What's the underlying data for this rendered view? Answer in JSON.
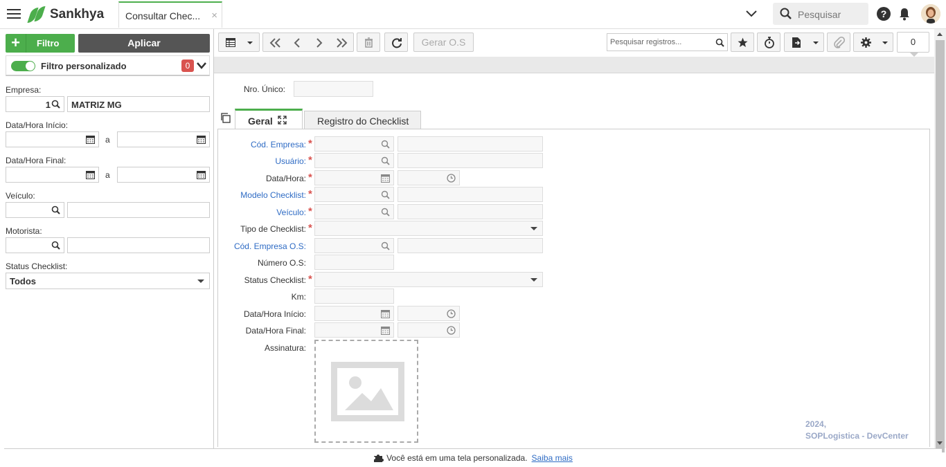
{
  "header": {
    "brand": "Sankhya",
    "tab_title": "Consultar Chec...",
    "tab_close": "×",
    "search_placeholder": "Pesquisar",
    "help_label": "?"
  },
  "filter_panel": {
    "filtro_button": "Filtro",
    "aplicar_button": "Aplicar",
    "custom_filter_label": "Filtro personalizado",
    "custom_filter_count": "0",
    "empresa_label": "Empresa:",
    "empresa_code": "1",
    "empresa_name": "MATRIZ MG",
    "data_inicio_label": "Data/Hora Início:",
    "data_final_label": "Data/Hora Final:",
    "range_sep": "a",
    "veiculo_label": "Veículo:",
    "motorista_label": "Motorista:",
    "status_label": "Status Checklist:",
    "status_value": "Todos"
  },
  "toolbar": {
    "gerar_os": "Gerar O.S",
    "search_placeholder": "Pesquisar registros...",
    "record_count": "0"
  },
  "form": {
    "nro_unico_label": "Nro. Único:",
    "tabs": [
      {
        "label": "Geral"
      },
      {
        "label": "Registro do Checklist"
      }
    ],
    "fields": {
      "cod_empresa": "Cód. Empresa:",
      "usuario": "Usuário:",
      "data_hora": "Data/Hora:",
      "modelo_checklist": "Modelo Checklist:",
      "veiculo": "Veículo:",
      "tipo_checklist": "Tipo de Checklist:",
      "cod_empresa_os": "Cód. Empresa O.S:",
      "numero_os": "Número O.S:",
      "status_checklist": "Status Checklist:",
      "km": "Km:",
      "data_hora_inicio": "Data/Hora Início:",
      "data_hora_final": "Data/Hora Final:",
      "assinatura": "Assinatura:"
    },
    "required_mark": "*"
  },
  "dev_note": {
    "line1": "2024,",
    "line2": "SOPLogistica - DevCenter"
  },
  "footer": {
    "text": "Você está em uma tela personalizada.",
    "link": "Saiba mais"
  },
  "colors": {
    "brand_green": "#4cae4c",
    "required_red": "#d9534f",
    "link_blue": "#2e6bc4",
    "dark_button": "#555555"
  }
}
